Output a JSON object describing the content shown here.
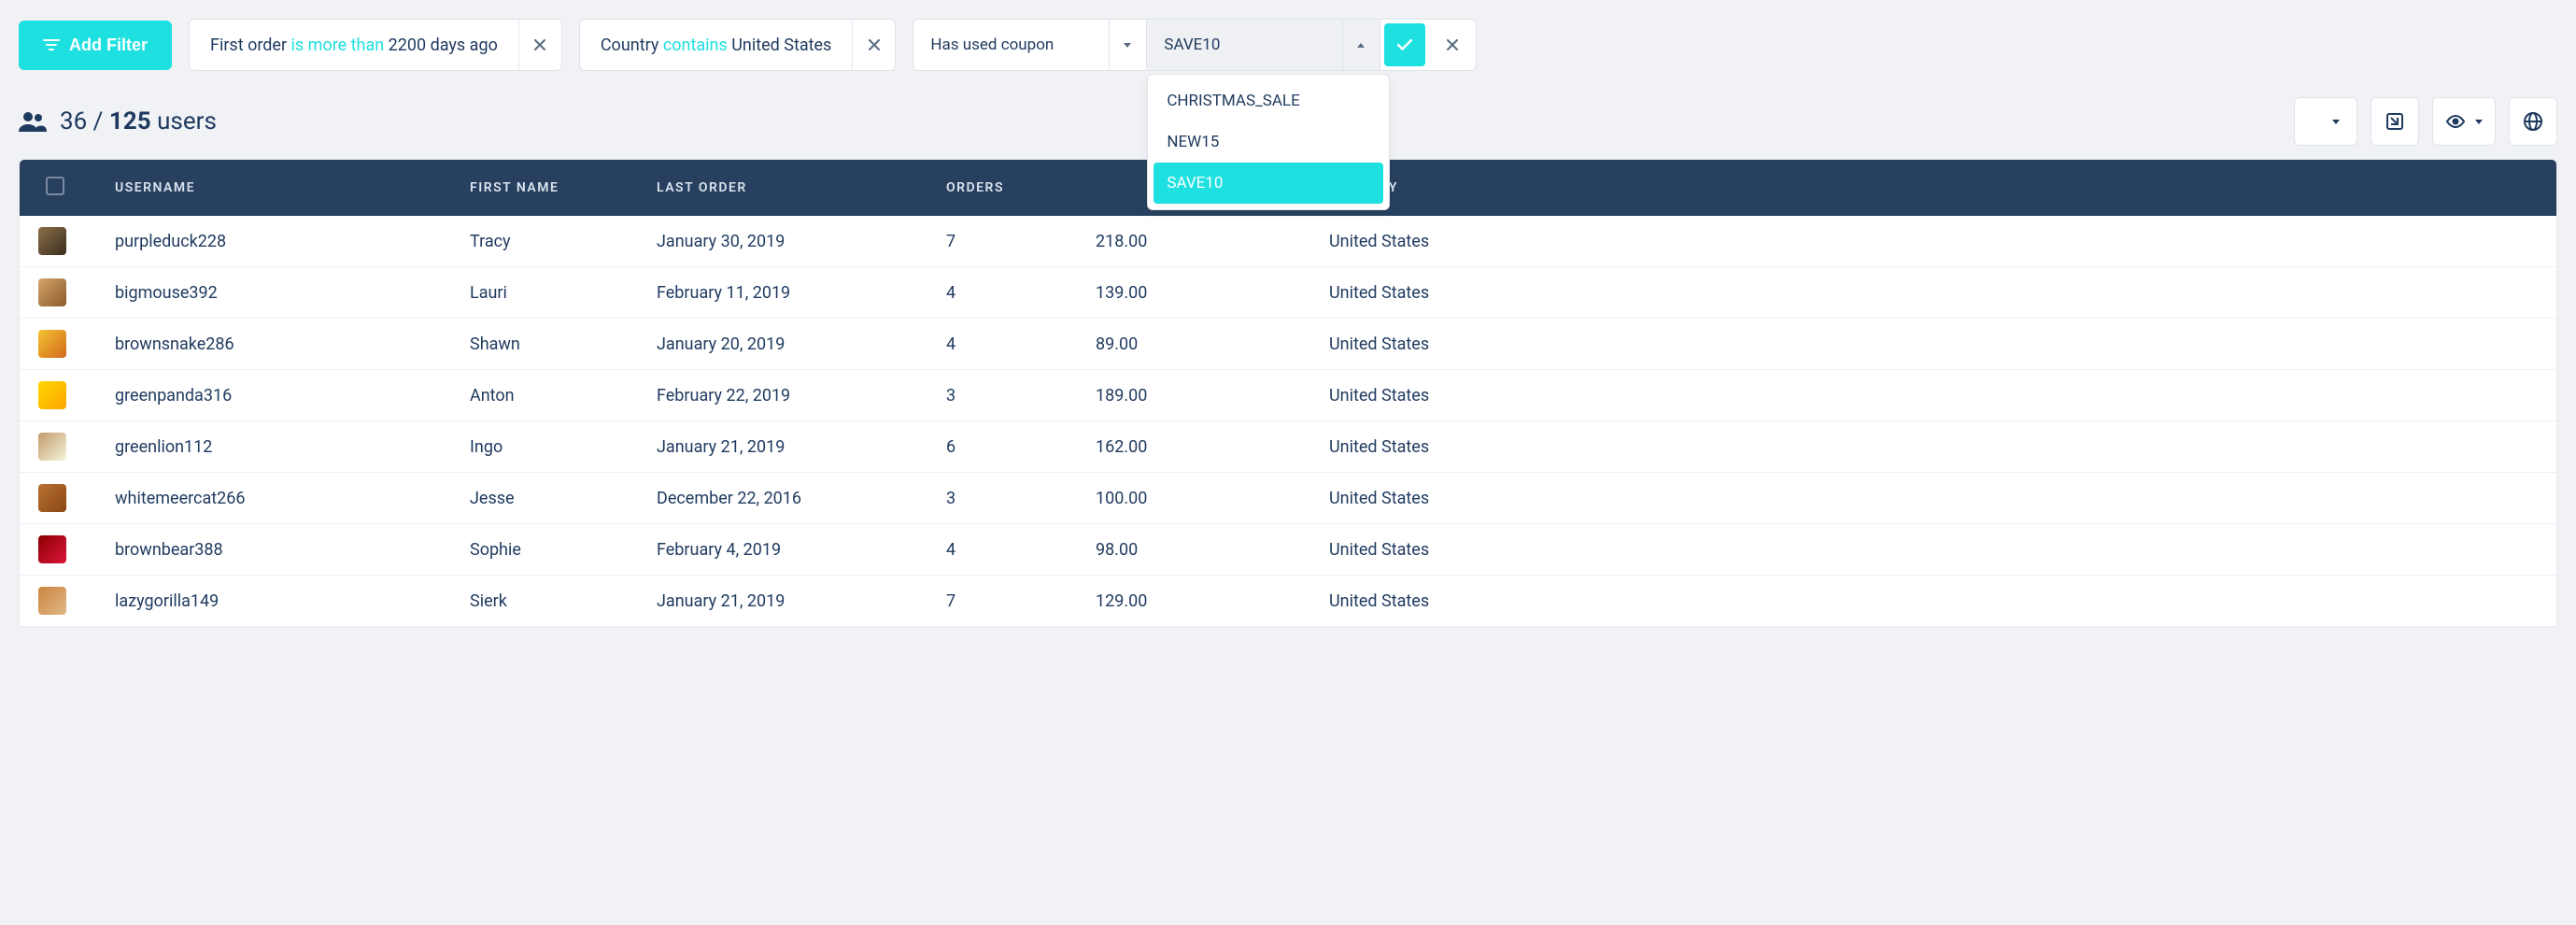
{
  "filter_bar": {
    "add_filter_label": "Add Filter",
    "chips": [
      {
        "pre": "First order ",
        "op": "is more than ",
        "post": "2200 days ago"
      },
      {
        "pre": "Country ",
        "op": "contains ",
        "post": "United States"
      }
    ],
    "builder": {
      "attribute": "Has used coupon",
      "value": "SAVE10",
      "options": [
        "CHRISTMAS_SALE",
        "NEW15",
        "SAVE10"
      ],
      "selected_option": "SAVE10"
    }
  },
  "stats": {
    "filtered": "36",
    "sep": " / ",
    "total": "125",
    "label": " users"
  },
  "table": {
    "headers": {
      "username": "USERNAME",
      "first_name": "FIRST NAME",
      "last_order": "LAST ORDER",
      "orders": "ORDERS",
      "amount": "",
      "country": "COUNTRY"
    },
    "rows": [
      {
        "username": "purpleduck228",
        "first_name": "Tracy",
        "last_order": "January 30, 2019",
        "orders": "7",
        "amount": "218.00",
        "country": "United States"
      },
      {
        "username": "bigmouse392",
        "first_name": "Lauri",
        "last_order": "February 11, 2019",
        "orders": "4",
        "amount": "139.00",
        "country": "United States"
      },
      {
        "username": "brownsnake286",
        "first_name": "Shawn",
        "last_order": "January 20, 2019",
        "orders": "4",
        "amount": "89.00",
        "country": "United States"
      },
      {
        "username": "greenpanda316",
        "first_name": "Anton",
        "last_order": "February 22, 2019",
        "orders": "3",
        "amount": "189.00",
        "country": "United States"
      },
      {
        "username": "greenlion112",
        "first_name": "Ingo",
        "last_order": "January 21, 2019",
        "orders": "6",
        "amount": "162.00",
        "country": "United States"
      },
      {
        "username": "whitemeercat266",
        "first_name": "Jesse",
        "last_order": "December 22, 2016",
        "orders": "3",
        "amount": "100.00",
        "country": "United States"
      },
      {
        "username": "brownbear388",
        "first_name": "Sophie",
        "last_order": "February 4, 2019",
        "orders": "4",
        "amount": "98.00",
        "country": "United States"
      },
      {
        "username": "lazygorilla149",
        "first_name": "Sierk",
        "last_order": "January 21, 2019",
        "orders": "7",
        "amount": "129.00",
        "country": "United States"
      }
    ]
  }
}
